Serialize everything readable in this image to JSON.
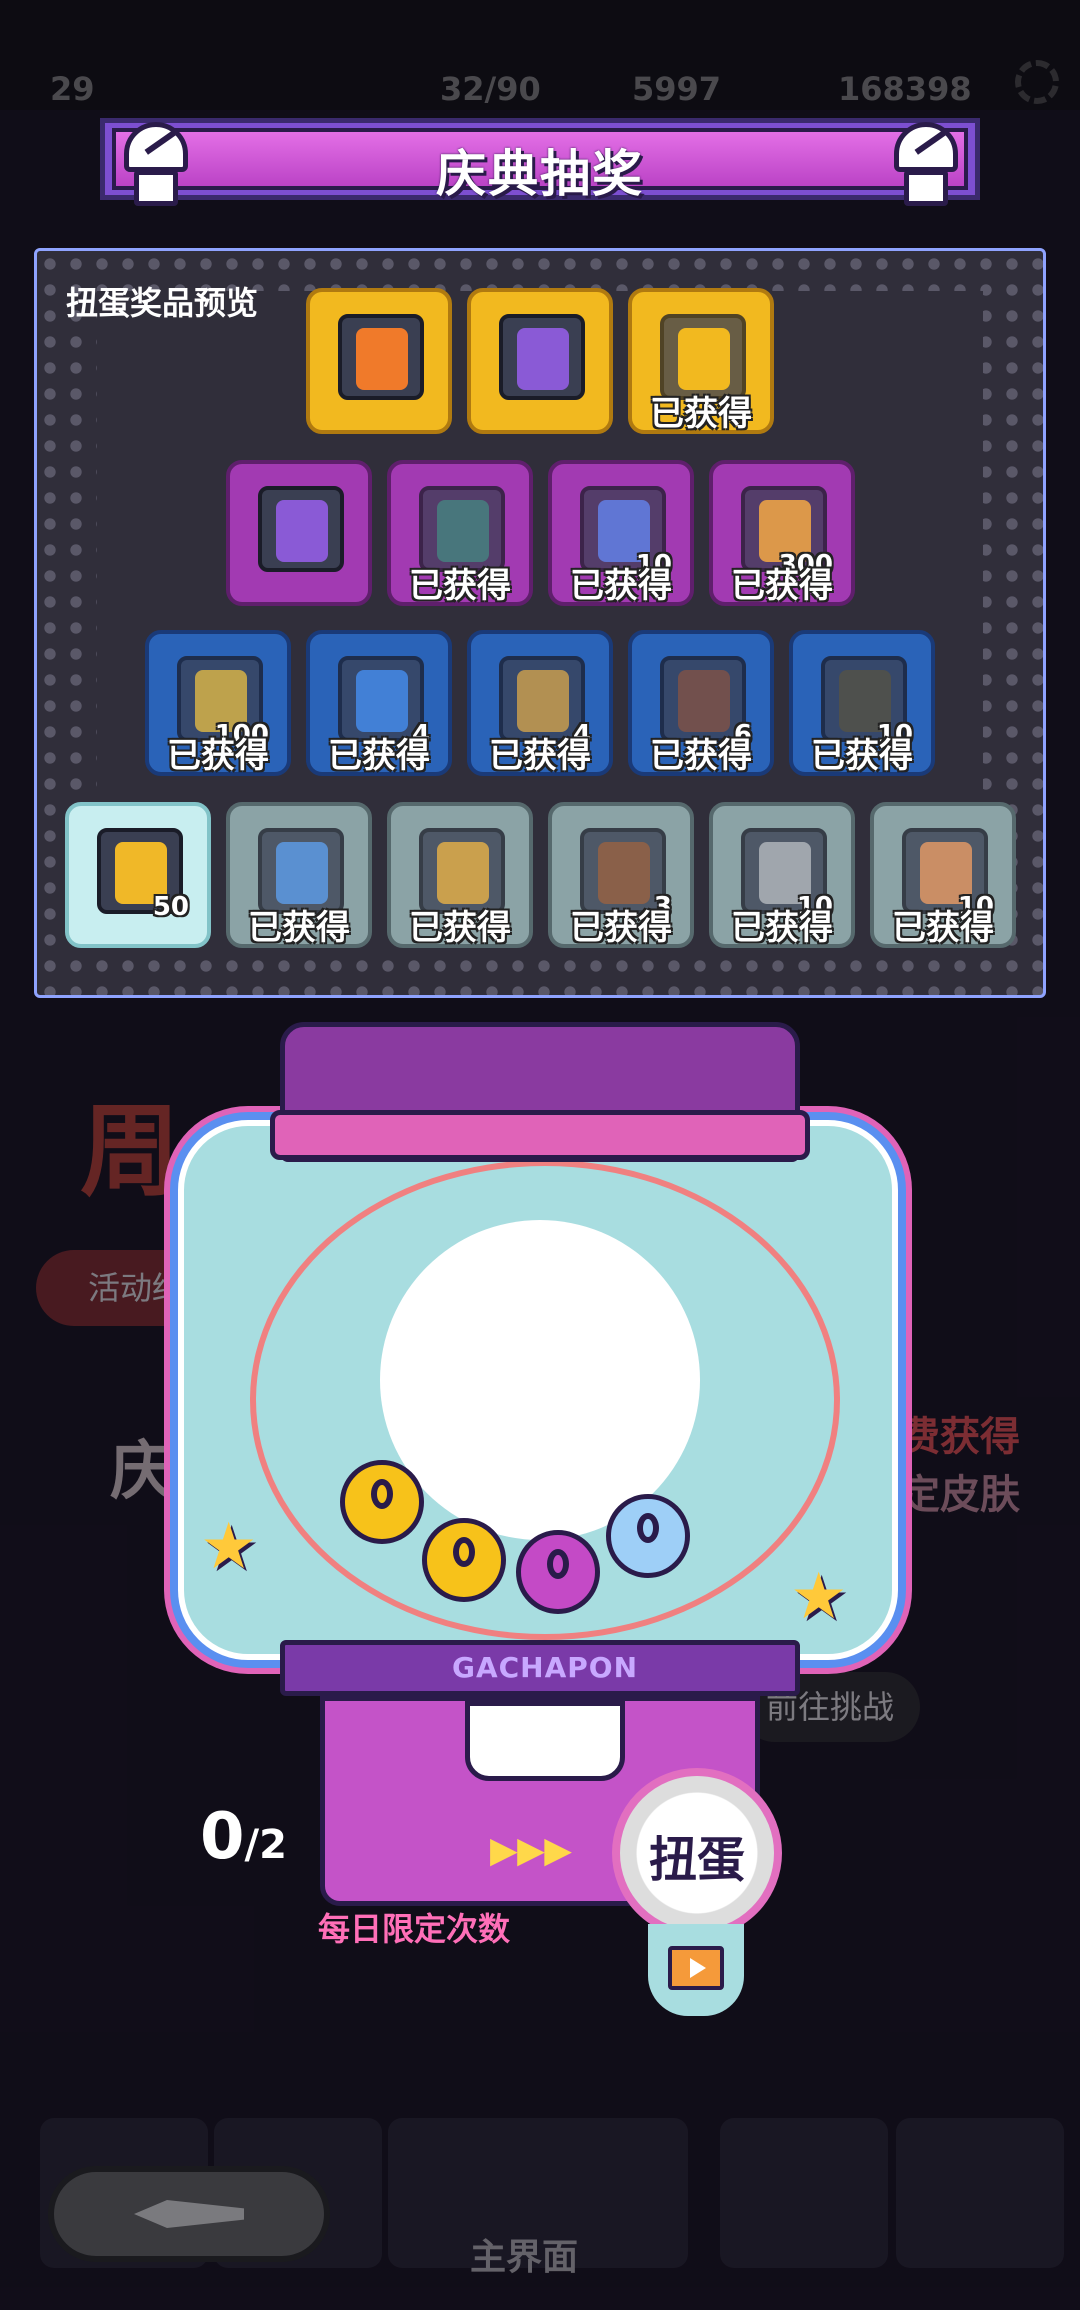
{
  "top_bar": {
    "level": "29",
    "energy": "32/90",
    "gold": "5997",
    "coins": "168398"
  },
  "banner": {
    "title": "庆典抽奖"
  },
  "panel": {
    "title": "扭蛋奖品预览",
    "obtained_label": "已获得",
    "rows": [
      {
        "tier": "gold",
        "items": [
          {
            "icon": "s-rank-icon",
            "qty": "",
            "obtained": false
          },
          {
            "icon": "character-portrait-icon",
            "qty": "",
            "obtained": false
          },
          {
            "icon": "number-one-icon",
            "qty": "",
            "obtained": true
          }
        ]
      },
      {
        "tier": "purple",
        "items": [
          {
            "icon": "character-portrait-icon",
            "qty": "",
            "obtained": false
          },
          {
            "icon": "frog-avatar-icon",
            "qty": "",
            "obtained": true
          },
          {
            "icon": "ticket-icon",
            "qty": "10",
            "obtained": true
          },
          {
            "icon": "gold-card-icon",
            "qty": "300",
            "obtained": true
          }
        ]
      },
      {
        "tier": "blue",
        "items": [
          {
            "icon": "gold-card-icon",
            "qty": "100",
            "obtained": true
          },
          {
            "icon": "ticket-icon",
            "qty": "4",
            "obtained": true
          },
          {
            "icon": "gold-key-icon",
            "qty": "4",
            "obtained": true
          },
          {
            "icon": "wooden-box-icon",
            "qty": "6",
            "obtained": true
          },
          {
            "icon": "mystery-badge-icon",
            "qty": "10",
            "obtained": true
          }
        ]
      },
      {
        "tier": "teal",
        "items": [
          {
            "icon": "gold-card-icon",
            "qty": "50",
            "obtained": false
          },
          {
            "icon": "ticket-icon",
            "qty": "",
            "obtained": true
          },
          {
            "icon": "gold-key-icon",
            "qty": "",
            "obtained": true
          },
          {
            "icon": "wooden-box-icon",
            "qty": "3",
            "obtained": true
          },
          {
            "icon": "silver-key-icon",
            "qty": "10",
            "obtained": true
          },
          {
            "icon": "ore-icon",
            "qty": "10",
            "obtained": true
          }
        ]
      }
    ]
  },
  "machine": {
    "label": "GACHAPON",
    "count_current": "0",
    "count_total": "/2",
    "spin_button": "扭蛋",
    "daily_limit": "每日限定次数"
  },
  "background": {
    "anniversary": "周",
    "activity": "活动结",
    "challenge": "前往挑战",
    "free_get": "费获得",
    "skin": "定皮肤",
    "celebration": "庆",
    "home_label": "主界面"
  },
  "colors": {
    "gold_tier": "#f2b91f",
    "purple_tier": "#a23ab2",
    "blue_tier": "#2a63b8",
    "teal_tier": "#8ba3a6",
    "accent_pink": "#e063b8"
  }
}
